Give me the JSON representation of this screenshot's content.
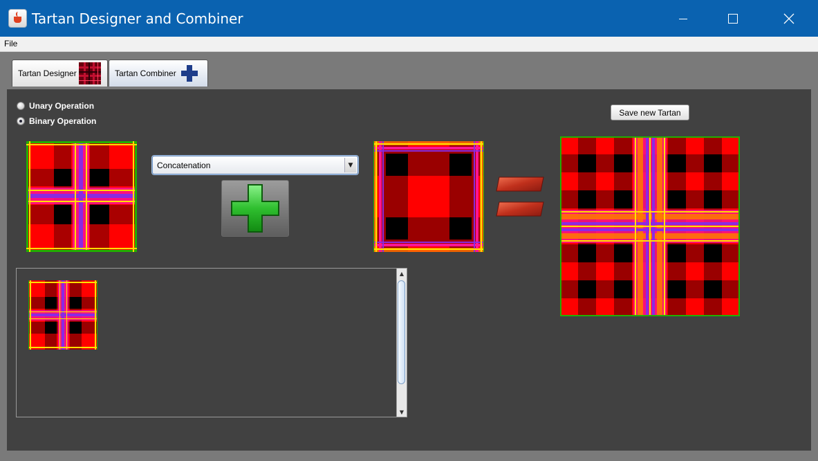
{
  "window": {
    "title": "Tartan Designer and Combiner",
    "controls": [
      "minimize-icon",
      "maximize-icon",
      "close-icon"
    ]
  },
  "menu": {
    "items": [
      "File"
    ]
  },
  "tabs": [
    {
      "label": "Tartan Designer",
      "icon": "tartan-thumbnail-icon"
    },
    {
      "label": "Tartan Combiner",
      "icon": "plus-icon"
    }
  ],
  "mode": {
    "options": [
      "Unary Operation",
      "Binary Operation"
    ],
    "selected": "Binary Operation"
  },
  "operation": {
    "selected": "Concatenation",
    "button_icon": "green-plus-icon"
  },
  "result": {
    "equals_icon": "equals-icon"
  },
  "actions": {
    "save_label": "Save new Tartan"
  },
  "colors": {
    "titlebar": "#0a62b0",
    "panel": "#414141",
    "tartan_red": "#ff0000",
    "tartan_dark_red": "#9a0000",
    "tartan_black": "#000000",
    "tartan_pink": "#ff1493",
    "tartan_yellow": "#ffe000",
    "tartan_purple": "#8a2be2",
    "tartan_green": "#22b000",
    "tartan_orange": "#ff7a00",
    "plus_green": "#2fbf2f"
  }
}
